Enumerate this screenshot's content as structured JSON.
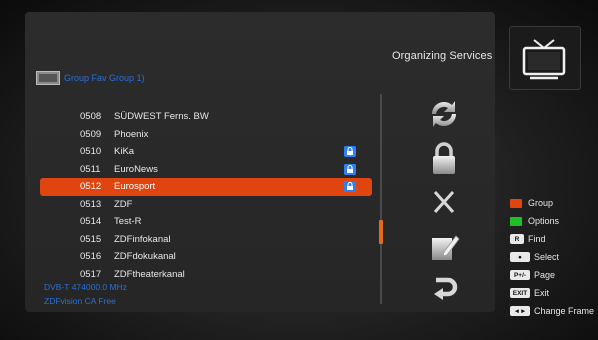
{
  "header": {
    "title": "Organizing Services"
  },
  "group": {
    "label": "Group Fav Group 1)"
  },
  "channels": [
    {
      "num": "0508",
      "name": "SÜDWEST Ferns. BW",
      "locked": false
    },
    {
      "num": "0509",
      "name": "Phoenix",
      "locked": false
    },
    {
      "num": "0510",
      "name": "KiKa",
      "locked": true
    },
    {
      "num": "0511",
      "name": "EuroNews",
      "locked": true
    },
    {
      "num": "0512",
      "name": "Eurosport",
      "locked": true,
      "selected": true
    },
    {
      "num": "0513",
      "name": "ZDF",
      "locked": false
    },
    {
      "num": "0514",
      "name": "Test-R",
      "locked": false
    },
    {
      "num": "0515",
      "name": "ZDFinfokanal",
      "locked": false
    },
    {
      "num": "0516",
      "name": "ZDFdokukanal",
      "locked": false
    },
    {
      "num": "0517",
      "name": "ZDFtheaterkanal",
      "locked": false
    }
  ],
  "info": {
    "frequency": "DVB-T 474000.0 MHz",
    "provider": "ZDFvision  CA Free"
  },
  "tools": [
    {
      "name": "move-icon"
    },
    {
      "name": "lock-icon"
    },
    {
      "name": "delete-icon"
    },
    {
      "name": "rename-icon"
    },
    {
      "name": "back-icon"
    }
  ],
  "legend": {
    "group": "Group",
    "options": "Options",
    "find_key": "R",
    "find": "Find",
    "select_key": "●",
    "select": "Select",
    "page_key": "P+/-",
    "page": "Page",
    "exit_key": "EXIT",
    "exit": "Exit",
    "change_key": "◄►",
    "change": "Change Frame"
  },
  "colors": {
    "accent": "#e0450f",
    "info_text": "#2b6fd6",
    "red_key": "#e0450f",
    "green_key": "#1fbf2a",
    "lock_badge": "#2f7ff0"
  }
}
